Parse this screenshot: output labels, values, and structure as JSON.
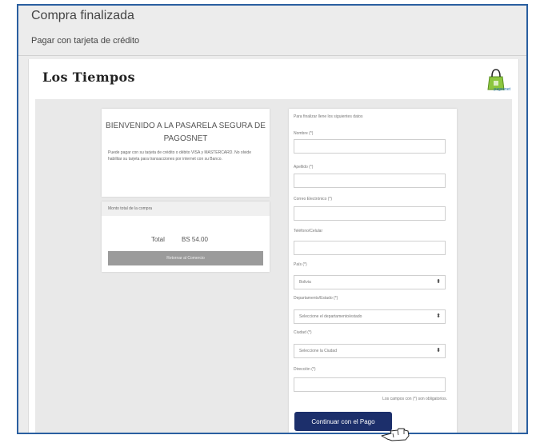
{
  "header": {
    "title": "Compra finalizada",
    "subtitle": "Pagar con tarjeta de crédito"
  },
  "brand": {
    "newspaper_logo": "Los Tiempos",
    "gateway_logo": "pagosnet"
  },
  "welcome": {
    "title": "BIENVENIDO A LA PASARELA SEGURA DE PAGOSNET",
    "body": "Puede pagar con su tarjeta de crédito o débito VISA y MASTERCARD. No olvide habilitar su tarjeta para transacciones por internet con su Banco."
  },
  "summary": {
    "header": "Monto total de la compra",
    "total_label": "Total",
    "total_value": "BS 54.00",
    "return_button": "Retornar al Comercio"
  },
  "form": {
    "intro": "Para finalizar llene los siguientes datos",
    "name_label": "Nombre (*)",
    "lastname_label": "Apellido (*)",
    "email_label": "Correo Electrónico (*)",
    "phone_label": "Teléfono/Celular",
    "country_label": "País (*)",
    "country_value": "Bolivia",
    "state_label": "Departamento/Estado (*)",
    "state_value": "Seleccione el departamento/estado",
    "city_label": "Ciudad (*)",
    "city_value": "Seleccione la Ciudad",
    "address_label": "Dirección (*)",
    "required_note": "Los campos con (*) son obligatorios.",
    "submit_button": "Continuar con el Pago"
  },
  "colors": {
    "frame_border": "#2a5fa0",
    "submit_button_bg": "#1c2f6b",
    "return_button_bg": "#9b9b9b"
  },
  "icons": {
    "pagosnet_logo": "pagosnet-bag-icon",
    "cursor": "hand-pointer-icon",
    "dropdown": "updown-caret-icon"
  }
}
